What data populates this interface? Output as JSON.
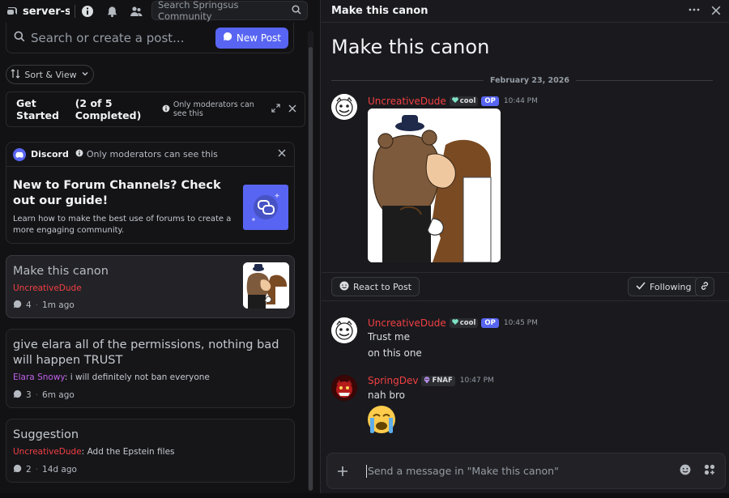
{
  "colors": {
    "accent": "#5865f2",
    "op_author": "#f23f43",
    "elara": "#c061e8",
    "background": "#1a1a1e"
  },
  "left": {
    "topbar": {
      "server_name": "server-sup",
      "search_placeholder": "Search Springsus Community"
    },
    "post_search": {
      "placeholder": "Search or create a post...",
      "new_post_label": "New Post"
    },
    "sort_label": "Sort & View",
    "get_started": {
      "title": "Get Started",
      "count": "(2 of 5 Completed)",
      "mod_note": "Only moderators can see this"
    },
    "guide": {
      "brand": "Discord",
      "mod_note": "Only moderators can see this",
      "title": "New to Forum Channels? Check out our guide!",
      "desc": "Learn how to make the best use of forums to create a more engaging community."
    },
    "posts": [
      {
        "title": "Make this canon",
        "author": "UncreativeDude",
        "preview": "",
        "replies": "4",
        "age": "1m ago"
      },
      {
        "title": "give elara all of the permissions, nothing bad will happen TRUST",
        "author": "Elara Snowy",
        "preview": "i will definitely not ban everyone",
        "replies": "3",
        "age": "6m ago"
      },
      {
        "title": "Suggestion",
        "author": "UncreativeDude",
        "preview": "Add the Epstein files",
        "replies": "2",
        "age": "14d ago"
      }
    ]
  },
  "right": {
    "header_title": "Make this canon",
    "post_title": "Make this canon",
    "date": "February 23, 2026",
    "messages": [
      {
        "author": "UncreativeDude",
        "tag": "cool",
        "op": "OP",
        "time": "10:44 PM"
      },
      {
        "author": "UncreativeDude",
        "tag": "cool",
        "op": "OP",
        "time": "10:45 PM",
        "lines": [
          "Trust me",
          "on this one"
        ]
      },
      {
        "author": "SpringDev",
        "tag": "FNAF",
        "time": "10:47 PM",
        "lines": [
          "nah bro",
          "😭"
        ]
      }
    ],
    "actions": {
      "react_label": "React to Post",
      "following_label": "Following"
    },
    "composer_placeholder": "Send a message in \"Make this canon\""
  }
}
